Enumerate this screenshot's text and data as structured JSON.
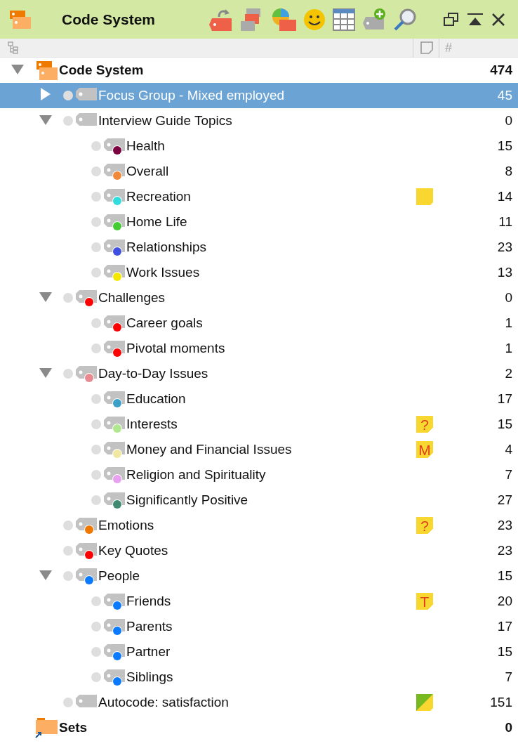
{
  "window": {
    "title": "Code System"
  },
  "columns": {
    "count_header": "#"
  },
  "tree": {
    "label": "Code System",
    "count": "474",
    "expanded": true,
    "selected": false,
    "children": [
      {
        "label": "Focus Group - Mixed employed",
        "count": "45",
        "expanded": false,
        "selected": true
      },
      {
        "label": "Interview Guide Topics",
        "count": "0",
        "expanded": true,
        "selected": false,
        "children": [
          {
            "label": "Health",
            "count": "15",
            "selected": false,
            "color": "#7a0040"
          },
          {
            "label": "Overall",
            "count": "8",
            "selected": false,
            "color": "#f08a3a"
          },
          {
            "label": "Recreation",
            "count": "14",
            "selected": false,
            "color": "#33dddd",
            "memo": {
              "kind": "note"
            }
          },
          {
            "label": "Home Life",
            "count": "11",
            "selected": false,
            "color": "#44cc33"
          },
          {
            "label": "Relationships",
            "count": "23",
            "selected": false,
            "color": "#3f4fe0"
          },
          {
            "label": "Work Issues",
            "count": "13",
            "selected": false,
            "color": "#f5e800"
          }
        ]
      },
      {
        "label": "Challenges",
        "count": "0",
        "expanded": true,
        "selected": false,
        "color": "#ff0000",
        "children": [
          {
            "label": "Career goals",
            "count": "1",
            "selected": false,
            "color": "#ff0000"
          },
          {
            "label": "Pivotal moments",
            "count": "1",
            "selected": false,
            "color": "#ff0000"
          }
        ]
      },
      {
        "label": "Day-to-Day Issues",
        "count": "2",
        "expanded": true,
        "selected": false,
        "color": "#e88a90",
        "children": [
          {
            "label": "Education",
            "count": "17",
            "selected": false,
            "color": "#3aa0c8"
          },
          {
            "label": "Interests",
            "count": "15",
            "selected": false,
            "color": "#b0e890",
            "memo": {
              "kind": "letter",
              "text": "?"
            }
          },
          {
            "label": "Money and Financial Issues",
            "count": "4",
            "selected": false,
            "color": "#f0e8a0",
            "memo": {
              "kind": "letter",
              "text": "M"
            }
          },
          {
            "label": "Religion and Spirituality",
            "count": "7",
            "selected": false,
            "color": "#e8a0f0"
          },
          {
            "label": "Significantly Positive",
            "count": "27",
            "selected": false,
            "color": "#3f8a70"
          }
        ]
      },
      {
        "label": "Emotions",
        "count": "23",
        "selected": false,
        "color": "#f07800",
        "memo": {
          "kind": "letter",
          "text": "?"
        }
      },
      {
        "label": "Key Quotes",
        "count": "23",
        "selected": false,
        "color": "#ff0000"
      },
      {
        "label": "People",
        "count": "15",
        "expanded": true,
        "selected": false,
        "color": "#0a7aff",
        "children": [
          {
            "label": "Friends",
            "count": "20",
            "selected": false,
            "color": "#0a7aff",
            "memo": {
              "kind": "letter",
              "text": "T"
            }
          },
          {
            "label": "Parents",
            "count": "17",
            "selected": false,
            "color": "#0a7aff"
          },
          {
            "label": "Partner",
            "count": "15",
            "selected": false,
            "color": "#0a7aff"
          },
          {
            "label": "Siblings",
            "count": "7",
            "selected": false,
            "color": "#0a7aff"
          }
        ]
      },
      {
        "label": "Autocode: satisfaction",
        "count": "151",
        "selected": false,
        "memo": {
          "kind": "autocode"
        }
      }
    ]
  },
  "sets": {
    "label": "Sets",
    "count": "0"
  }
}
